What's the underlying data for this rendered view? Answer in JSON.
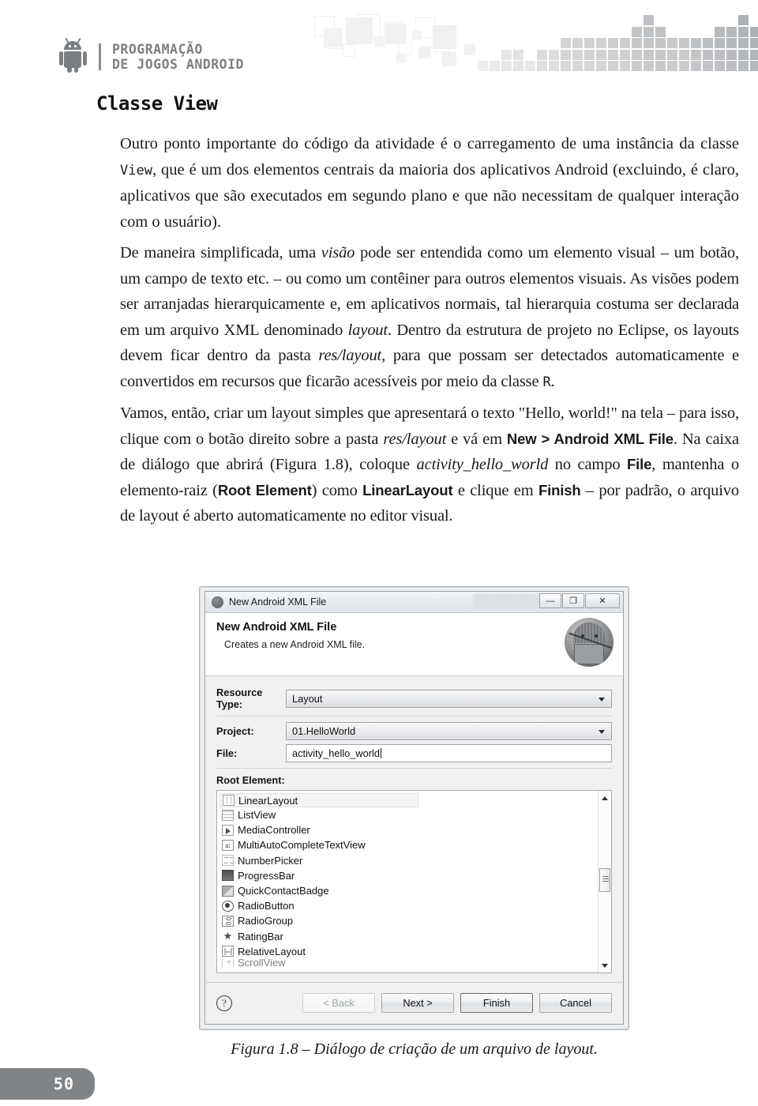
{
  "header": {
    "brand_line1": "PROGRAMAÇÃO",
    "brand_line2": "DE JOGOS ANDROID",
    "logo_icon": "android-robot-icon"
  },
  "chapter": {
    "title": "Classe View"
  },
  "body": {
    "p1_a": "Outro ponto importante do código da atividade é o carregamento de uma instância da classe ",
    "p1_code": "View",
    "p1_b": ", que é um dos elementos centrais da maioria dos aplicativos Android (excluindo, é claro, aplicativos que são executados em segundo plano e que não necessitam de qualquer interação com o usuário).",
    "p2_a": "De maneira simplificada, uma ",
    "p2_it1": "visão",
    "p2_b": " pode ser entendida como um elemento visual – um botão, um campo de texto etc. – ou como um contêiner para outros elementos visuais. As visões podem ser arranjadas hierarquicamente e, em aplicativos normais, tal hierarquia costuma ser declarada em um arquivo XML denominado ",
    "p2_it2": "layout",
    "p2_c": ". Dentro da estrutura de projeto no Eclipse, os layouts devem ficar dentro da pasta ",
    "p2_it3": "res/layout",
    "p2_d": ", para que possam ser detectados automaticamente e convertidos em recursos que ficarão acessíveis por meio da classe ",
    "p2_code": "R",
    "p2_e": ".",
    "p3_a": "Vamos, então, criar um layout simples que apresentará o texto \"Hello, world!\" na tela – para isso, clique com o botão direito sobre a pasta ",
    "p3_it1": "res/layout",
    "p3_b": " e vá em ",
    "p3_bd1": "New > Android XML File",
    "p3_c": ". Na caixa de diálogo que abrirá (Figura 1.8), coloque ",
    "p3_it2": "activity_hello_world",
    "p3_d": " no campo ",
    "p3_bd2": "File",
    "p3_e": ", mantenha o elemento-raiz (",
    "p3_bd3": "Root Element",
    "p3_f": ") como ",
    "p3_bd4": "LinearLayout",
    "p3_g": " e clique em ",
    "p3_bd5": "Finish",
    "p3_h": " – por padrão, o arquivo de layout é aberto automaticamente no editor visual."
  },
  "dialog": {
    "titlebar": {
      "title": "New Android XML File",
      "icon": "android-app-icon",
      "minimize_label": "—",
      "maximize_label": "❐",
      "close_label": "✕"
    },
    "banner": {
      "title": "New Android XML File",
      "subtitle": "Creates a new Android XML file.",
      "avatar_icon": "android-mascot-avatar-icon"
    },
    "fields": [
      {
        "label": "Resource Type:",
        "value": "Layout",
        "type": "combo"
      },
      {
        "label": "Project:",
        "value": "01.HelloWorld",
        "type": "combo"
      },
      {
        "label": "File:",
        "value": "activity_hello_world",
        "type": "text"
      }
    ],
    "root_element_label": "Root Element:",
    "root_element_items": [
      {
        "label": "LinearLayout",
        "icon": "linearlayout-icon",
        "selected": true
      },
      {
        "label": "ListView",
        "icon": "listview-icon",
        "selected": false
      },
      {
        "label": "MediaController",
        "icon": "mediacontroller-icon",
        "selected": false
      },
      {
        "label": "MultiAutoCompleteTextView",
        "icon": "textview-icon",
        "selected": false
      },
      {
        "label": "NumberPicker",
        "icon": "numberpicker-icon",
        "selected": false
      },
      {
        "label": "ProgressBar",
        "icon": "progressbar-icon",
        "selected": false
      },
      {
        "label": "QuickContactBadge",
        "icon": "quickcontact-icon",
        "selected": false
      },
      {
        "label": "RadioButton",
        "icon": "radiobutton-icon",
        "selected": false
      },
      {
        "label": "RadioGroup",
        "icon": "radiogroup-icon",
        "selected": false
      },
      {
        "label": "RatingBar",
        "icon": "ratingbar-icon",
        "selected": false
      },
      {
        "label": "RelativeLayout",
        "icon": "relativelayout-icon",
        "selected": false
      },
      {
        "label": "ScrollView",
        "icon": "scrollview-icon",
        "selected": false
      }
    ],
    "scrollbar": {
      "up_icon": "scroll-up-arrow-icon",
      "down_icon": "scroll-down-arrow-icon"
    },
    "buttons": {
      "help_label": "?",
      "back_label": "< Back",
      "next_label": "Next >",
      "finish_label": "Finish",
      "cancel_label": "Cancel"
    }
  },
  "figure": {
    "caption": "Figura 1.8 – Diálogo de criação de um arquivo de layout."
  },
  "footer": {
    "page_number": "50"
  },
  "colors": {
    "brand_grey": "#7c7f81",
    "page_tab_grey": "#808487",
    "text_black": "#1a1a1a",
    "dialog_bg": "#f0f0f0"
  }
}
